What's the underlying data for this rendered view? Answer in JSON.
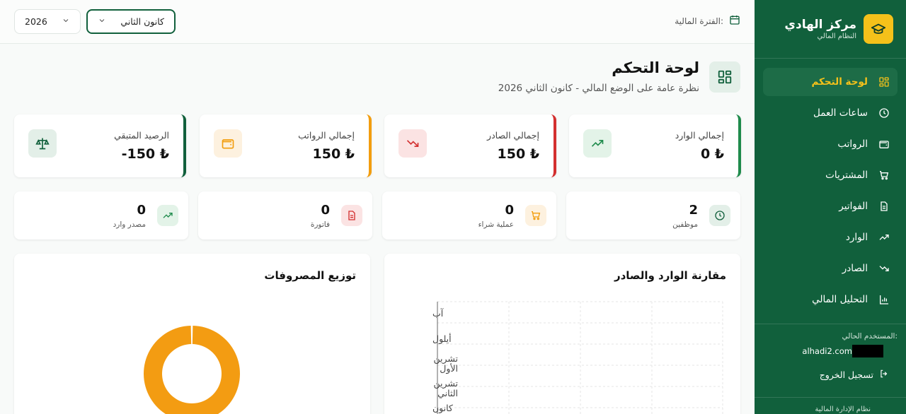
{
  "sidebar": {
    "brand_title": "مركز الهادي",
    "brand_subtitle": "النظام المالي",
    "items": [
      {
        "label": "لوحة التحكم",
        "icon": "dashboard-icon",
        "active": true
      },
      {
        "label": "ساعات العمل",
        "icon": "clock-icon"
      },
      {
        "label": "الرواتب",
        "icon": "wallet-icon"
      },
      {
        "label": "المشتريات",
        "icon": "cart-icon"
      },
      {
        "label": "الفواتير",
        "icon": "invoice-icon"
      },
      {
        "label": "الوارد",
        "icon": "trending-up-icon"
      },
      {
        "label": "الصادر",
        "icon": "trending-down-icon"
      },
      {
        "label": "التحليل المالي",
        "icon": "bar-chart-icon"
      }
    ],
    "user_label": "المستخدم الحالي:",
    "user_email": "alhadi2.com",
    "logout_label": "تسجيل الخروج",
    "footer": "نظام الإدارة المالية"
  },
  "topbar": {
    "period_label": "الفترة المالية:",
    "month_value": "كانون الثاني",
    "year_value": "2026"
  },
  "header": {
    "title": "لوحة التحكم",
    "subtitle": "نظرة عامة على الوضع المالي - كانون الثاني 2026"
  },
  "stats": [
    {
      "label": "إجمالي الوارد",
      "value": "0 ₺",
      "accent": "#1f8b4c",
      "icon": "trending-up-icon"
    },
    {
      "label": "إجمالي الصادر",
      "value": "150 ₺",
      "accent": "#d32f2f",
      "icon": "trending-down-icon"
    },
    {
      "label": "إجمالي الرواتب",
      "value": "150 ₺",
      "accent": "#f29d0e",
      "icon": "wallet-icon"
    },
    {
      "label": "الرصيد المتبقي",
      "value": "-150 ₺",
      "accent": "#11603c",
      "icon": "scale-icon"
    }
  ],
  "mini": [
    {
      "value": "2",
      "label": "موظفين",
      "icon": "clock-icon"
    },
    {
      "value": "0",
      "label": "عملية شراء",
      "icon": "cart-icon"
    },
    {
      "value": "0",
      "label": "فاتورة",
      "icon": "invoice-icon"
    },
    {
      "value": "0",
      "label": "مصدر وارد",
      "icon": "trending-up-icon"
    }
  ],
  "comparison_panel": {
    "title": "مقارنة الوارد والصادر",
    "months": [
      "آب",
      "أيلول",
      "تشرين الأول",
      "تشرين الثاني",
      "كانون"
    ]
  },
  "expenses_panel": {
    "title": "توزيع المصروفات"
  },
  "chart_data": [
    {
      "type": "bar",
      "title": "مقارنة الوارد والصادر",
      "categories": [
        "آب",
        "أيلول",
        "تشرين الأول",
        "تشرين الثاني",
        "كانون"
      ],
      "values": []
    },
    {
      "type": "pie",
      "title": "توزيع المصروفات",
      "values": [
        1
      ],
      "colors": [
        "#f39c12"
      ]
    }
  ]
}
